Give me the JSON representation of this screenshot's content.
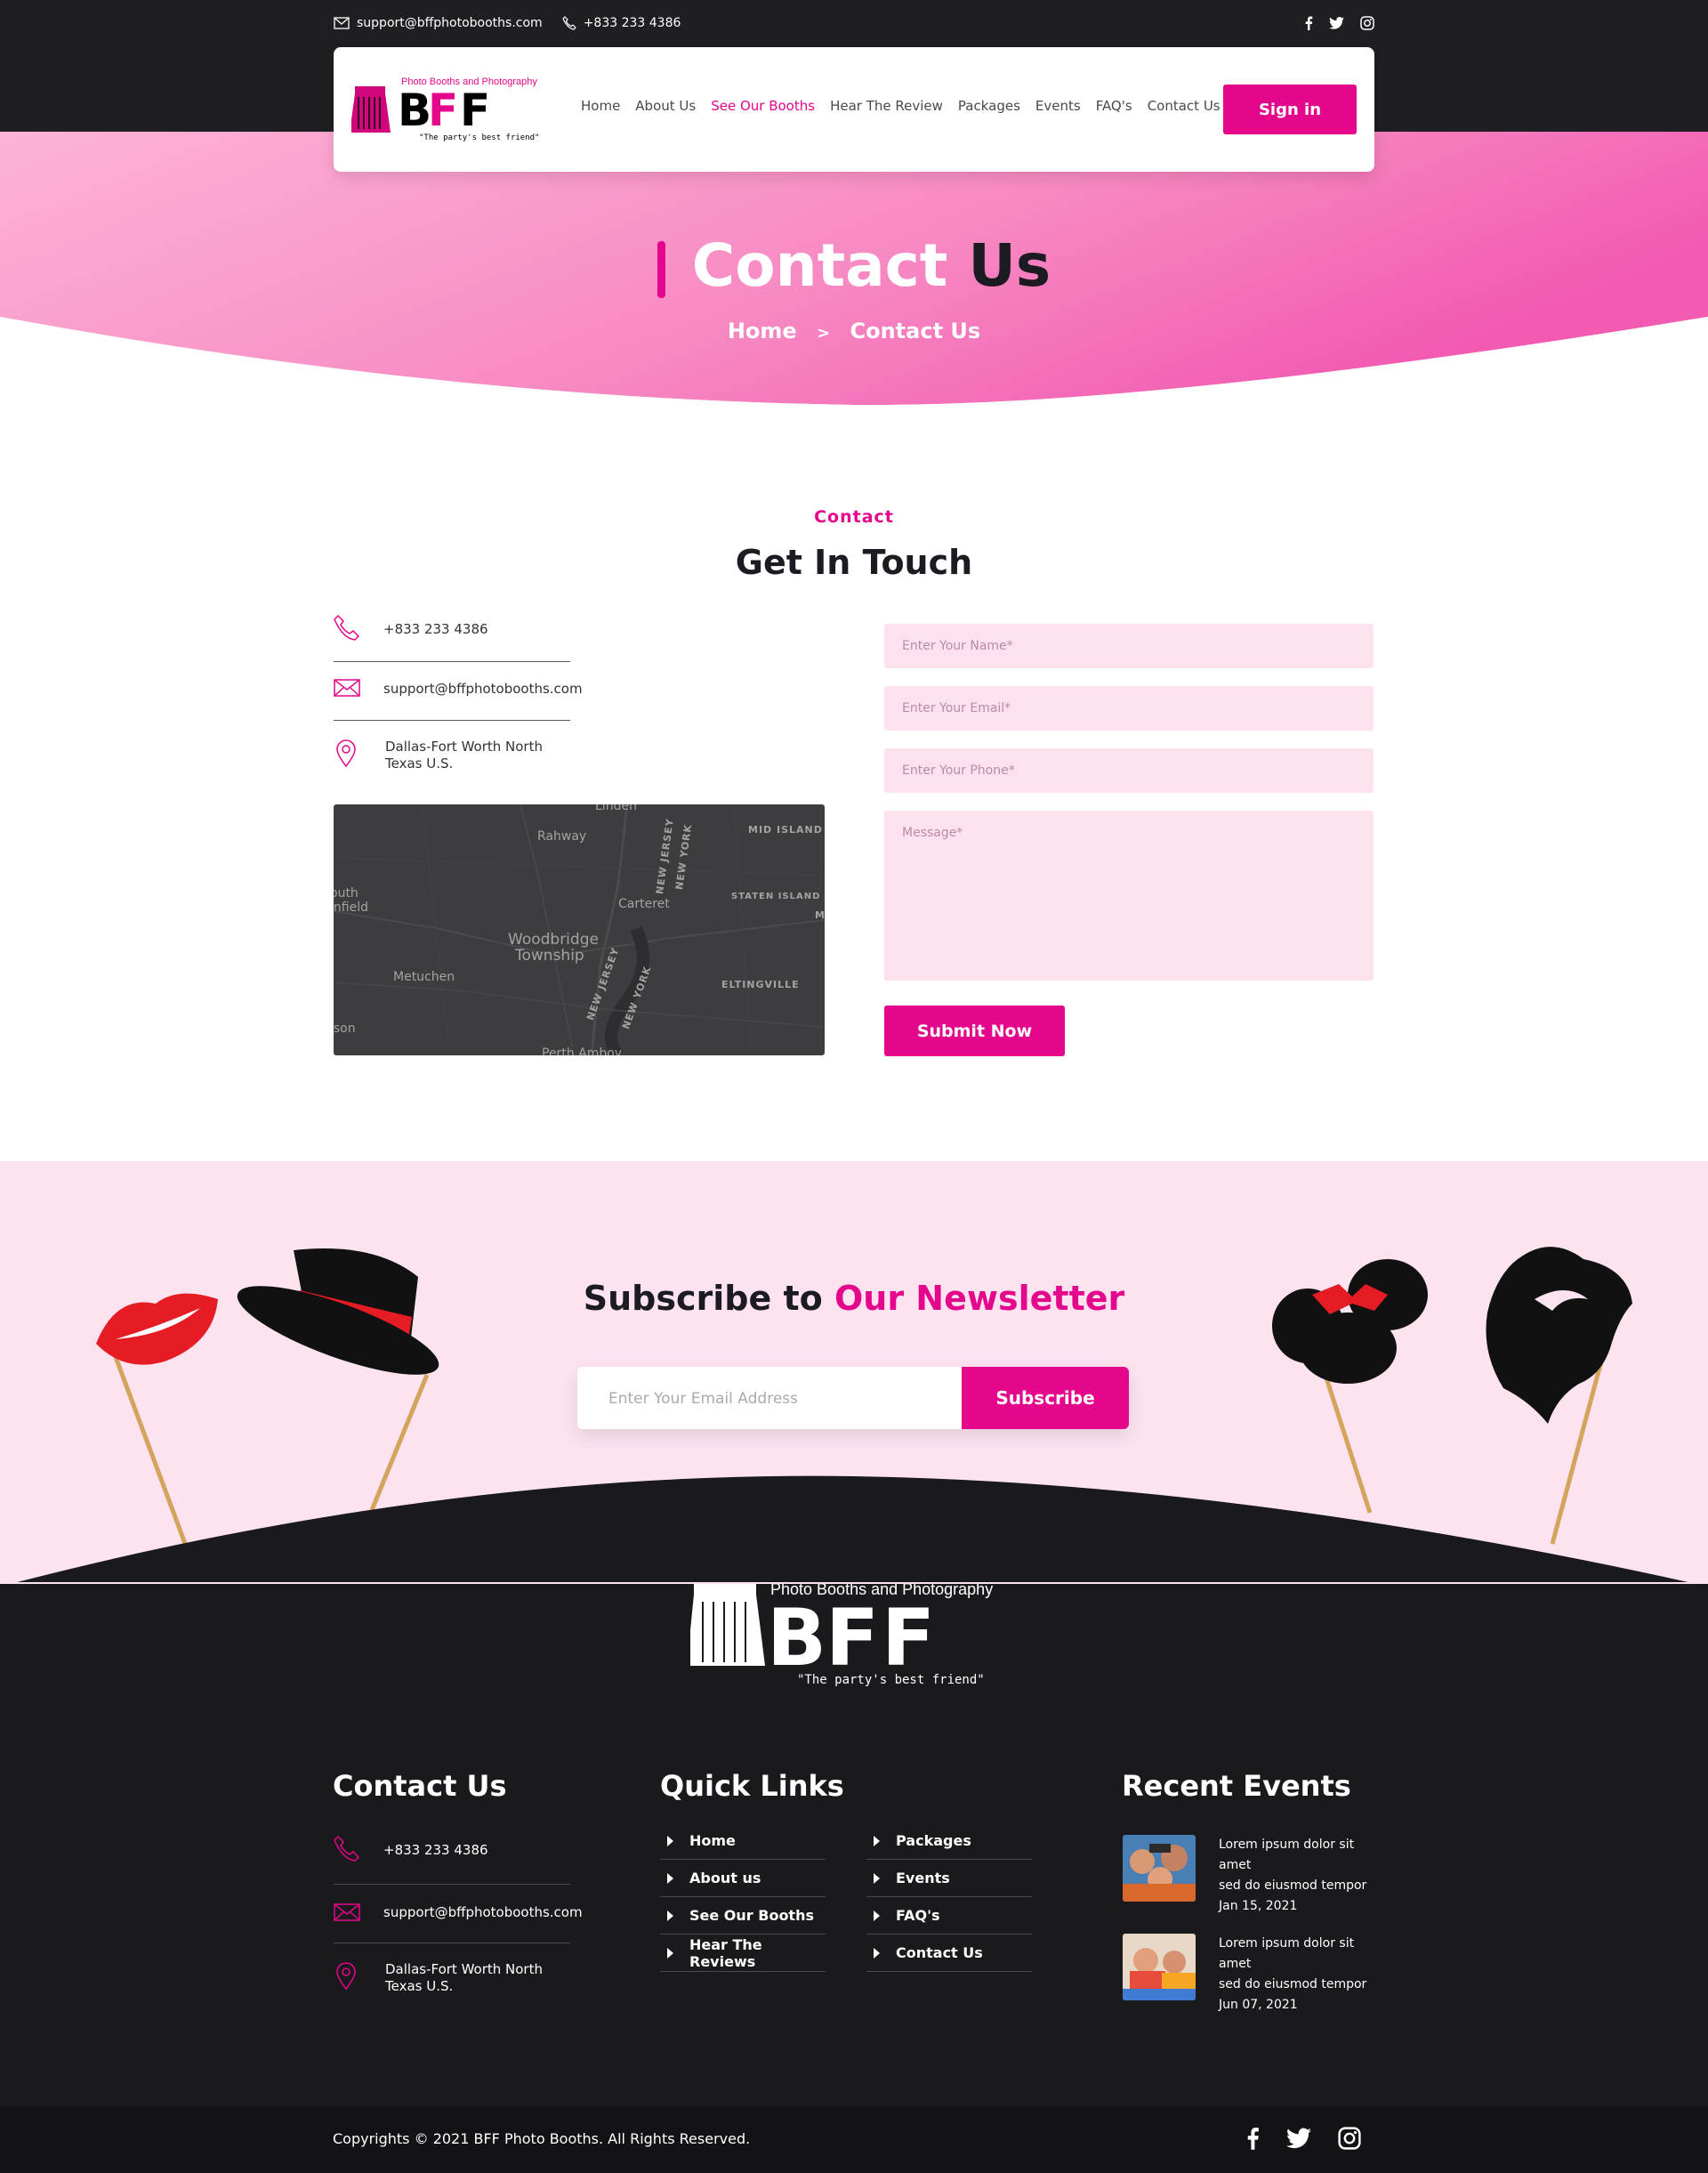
{
  "topbar": {
    "email": "support@bffphotobooths.com",
    "phone": "+833 233 4386",
    "social": [
      "facebook-icon",
      "twitter-icon",
      "instagram-icon"
    ]
  },
  "header": {
    "logo_top": "Photo Booths and Photography",
    "logo_main": "BFF",
    "logo_tagline": "\"The party's best friend\"",
    "nav": [
      "Home",
      "About Us",
      "See Our Booths",
      "Hear The Review",
      "Packages",
      "Events",
      "FAQ's",
      "Contact Us"
    ],
    "active_nav": "See Our Booths",
    "signin": "Sign in"
  },
  "hero": {
    "title_part1": "Contact",
    "title_part2": "Us",
    "crumb_home": "Home",
    "crumb_sep": ">",
    "crumb_current": "Contact Us"
  },
  "contact": {
    "tag": "Contact",
    "title": "Get In Touch",
    "phone": "+833 233 4386",
    "email": "support@bffphotobooths.com",
    "address_line1": "Dallas-Fort Worth North",
    "address_line2": "Texas U.S.",
    "map_labels": [
      "Linden",
      "Rahway",
      "MID ISLAND",
      "NEW JERSEY",
      "NEW YORK",
      "Carteret",
      "STATEN ISLAND",
      "outh",
      "infield",
      "Woodbridge",
      "Township",
      "Metuchen",
      "NEW JERSEY",
      "NEW YORK",
      "ELTINGVILLE",
      "ison",
      "M",
      "Perth Amboy"
    ],
    "form": {
      "name_placeholder": "Enter Your Name*",
      "email_placeholder": "Enter Your Email*",
      "phone_placeholder": "Enter Your Phone*",
      "message_placeholder": "Message*",
      "submit": "Submit Now"
    }
  },
  "newsletter": {
    "title_part1": "Subscribe to",
    "title_part2": "Our Newsletter",
    "placeholder": "Enter Your Email Address",
    "button": "Subscribe"
  },
  "footer": {
    "logo_top": "Photo Booths and Photography",
    "logo_main": "BFF",
    "logo_tagline": "\"The party's best friend\"",
    "contact_title": "Contact Us",
    "phone": "+833 233 4386",
    "email": "support@bffphotobooths.com",
    "address_line1": "Dallas-Fort Worth North",
    "address_line2": "Texas U.S.",
    "links_title": "Quick Links",
    "links_col1": [
      "Home",
      "About us",
      "See Our Booths",
      "Hear The Reviews"
    ],
    "links_col2": [
      "Packages",
      "Events",
      "FAQ's",
      "Contact Us"
    ],
    "events_title": "Recent Events",
    "events": [
      {
        "line1": "Lorem ipsum dolor sit amet",
        "line2": "sed do eiusmod tempor",
        "date": "Jan 15, 2021"
      },
      {
        "line1": "Lorem ipsum dolor sit amet",
        "line2": "sed do eiusmod tempor",
        "date": "Jun 07, 2021"
      }
    ],
    "copyright": "Copyrights © 2021 BFF Photo Booths. All Rights Reserved.",
    "social": [
      "facebook-icon",
      "twitter-icon",
      "instagram-icon"
    ]
  },
  "colors": {
    "accent": "#e4068b",
    "dark": "#1f1e22",
    "pink_light": "#fde3f0"
  }
}
